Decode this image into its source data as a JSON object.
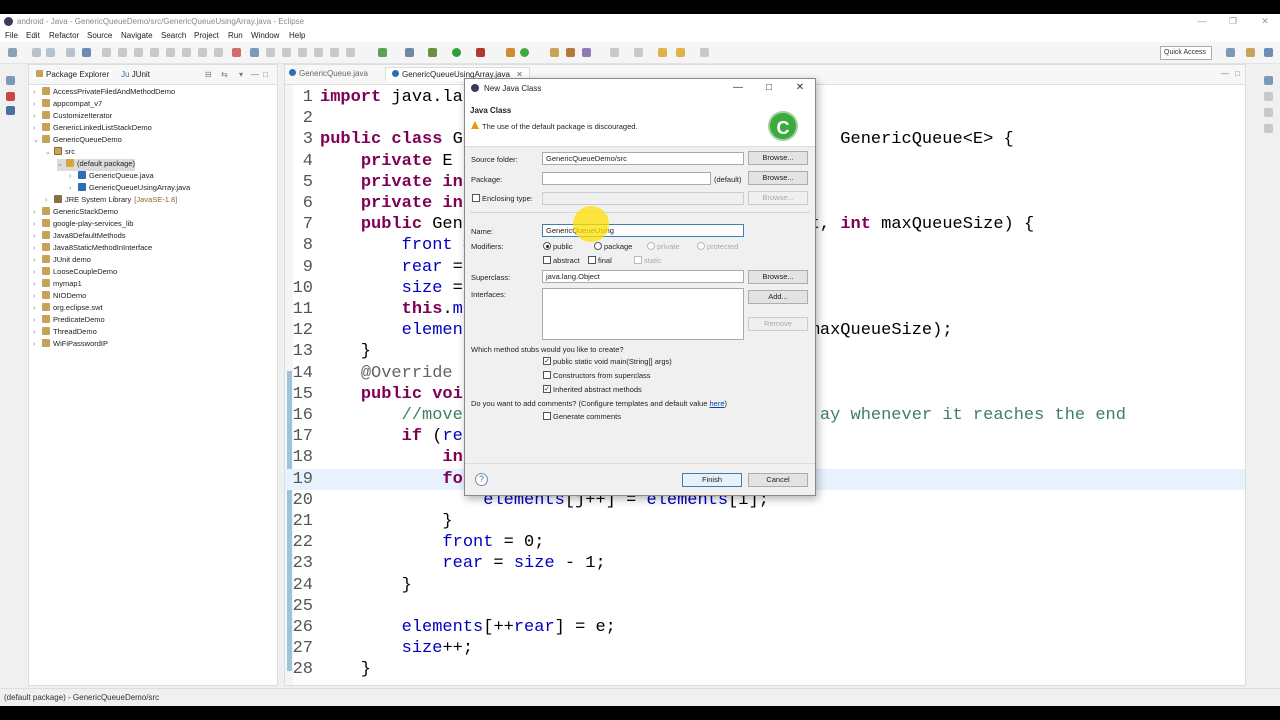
{
  "window": {
    "title": "android - Java - GenericQueueDemo/src/GenericQueueUsingArray.java - Eclipse"
  },
  "menu": [
    "File",
    "Edit",
    "Refactor",
    "Source",
    "Navigate",
    "Search",
    "Project",
    "Run",
    "Window",
    "Help"
  ],
  "toolbar": {
    "quick_access": "Quick Access"
  },
  "package_explorer": {
    "tabs": [
      "Package Explorer",
      "JUnit"
    ],
    "items": [
      {
        "label": "AccessPrivateFiledAndMethodDemo",
        "depth": 0,
        "expanded": false,
        "icon": "project"
      },
      {
        "label": "appcompat_v7",
        "depth": 0,
        "expanded": false,
        "icon": "project"
      },
      {
        "label": "CustomizeIterator",
        "depth": 0,
        "expanded": false,
        "icon": "project"
      },
      {
        "label": "GenericLinkedListStackDemo",
        "depth": 0,
        "expanded": false,
        "icon": "project"
      },
      {
        "label": "GenericQueueDemo",
        "depth": 0,
        "expanded": true,
        "icon": "project"
      },
      {
        "label": "src",
        "depth": 1,
        "expanded": true,
        "icon": "src"
      },
      {
        "label": "(default package)",
        "depth": 2,
        "expanded": true,
        "icon": "package",
        "selected": true
      },
      {
        "label": "GenericQueue.java",
        "depth": 3,
        "expanded": false,
        "icon": "java"
      },
      {
        "label": "GenericQueueUsingArray.java",
        "depth": 3,
        "expanded": false,
        "icon": "java"
      },
      {
        "label": "JRE System Library",
        "suffix": "[JavaSE-1.8]",
        "depth": 1,
        "expanded": false,
        "icon": "library"
      },
      {
        "label": "GenericStackDemo",
        "depth": 0,
        "expanded": false,
        "icon": "project"
      },
      {
        "label": "google-play-services_lib",
        "depth": 0,
        "expanded": false,
        "icon": "project"
      },
      {
        "label": "Java8DefaultMethods",
        "depth": 0,
        "expanded": false,
        "icon": "project"
      },
      {
        "label": "Java8StaticMethodInInterface",
        "depth": 0,
        "expanded": false,
        "icon": "project"
      },
      {
        "label": "JUnit demo",
        "depth": 0,
        "expanded": false,
        "icon": "project"
      },
      {
        "label": "LooseCoupleDemo",
        "depth": 0,
        "expanded": false,
        "icon": "project"
      },
      {
        "label": "mymap1",
        "depth": 0,
        "expanded": false,
        "icon": "project"
      },
      {
        "label": "NIODemo",
        "depth": 0,
        "expanded": false,
        "icon": "project"
      },
      {
        "label": "org.eclipse.swt",
        "depth": 0,
        "expanded": false,
        "icon": "project"
      },
      {
        "label": "PredicateDemo",
        "depth": 0,
        "expanded": false,
        "icon": "project"
      },
      {
        "label": "ThreadDemo",
        "depth": 0,
        "expanded": false,
        "icon": "project"
      },
      {
        "label": "WiFiPasswordIP",
        "depth": 0,
        "expanded": false,
        "icon": "project"
      }
    ]
  },
  "editor": {
    "tabs": [
      "GenericQueue.java",
      "GenericQueueUsingArray.java"
    ],
    "lines": [
      {
        "n": "1",
        "html": "<span class='kw'>import</span> java.lar"
      },
      {
        "n": "2",
        "html": ""
      },
      {
        "n": "3",
        "html": "<span class='kw'>public class</span> Ge                                    GenericQueue&lt;E&gt; {"
      },
      {
        "n": "4",
        "html": "    <span class='kw'>private</span> E <span class='fld'>e</span>"
      },
      {
        "n": "5",
        "html": "    <span class='kw'>private int</span>"
      },
      {
        "n": "6",
        "html": "    <span class='kw'>private int</span>"
      },
      {
        "n": "7",
        "html": "    <span class='kw'>public</span> Gene                                 t, <span class='kw'>int</span> maxQueueSize) {"
      },
      {
        "n": "8",
        "html": "        <span class='fld'>front</span> ="
      },
      {
        "n": "9",
        "html": "        <span class='fld'>rear</span> ="
      },
      {
        "n": "10",
        "html": "        <span class='fld'>size</span> ="
      },
      {
        "n": "11",
        "html": "        <span class='kw'>this</span>.<span class='fld'>ma</span>"
      },
      {
        "n": "12",
        "html": "        <span class='fld'>element</span>                                 maxQueueSize);"
      },
      {
        "n": "13",
        "html": "    }"
      },
      {
        "n": "14",
        "html": "    <span class='an'>@Override</span>"
      },
      {
        "n": "15",
        "html": "    <span class='kw'>public voi</span>"
      },
      {
        "n": "16",
        "html": "        <span class='cm'>//moves                                  ay whenever it reaches the end</span>"
      },
      {
        "n": "17",
        "html": "        <span class='kw'>if</span> (<span class='fld'>rea</span>"
      },
      {
        "n": "18",
        "html": "            <span class='kw'>int</span>"
      },
      {
        "n": "19",
        "html": "            <span class='kw'>for</span>"
      },
      {
        "n": "20",
        "html": "                <span class='fld'>elements</span>[j++] = <span class='fld'>elements</span>[i];"
      },
      {
        "n": "21",
        "html": "            }"
      },
      {
        "n": "22",
        "html": "            <span class='fld'>front</span> = 0;"
      },
      {
        "n": "23",
        "html": "            <span class='fld'>rear</span> = <span class='fld'>size</span> - 1;"
      },
      {
        "n": "24",
        "html": "        }"
      },
      {
        "n": "25",
        "html": ""
      },
      {
        "n": "26",
        "html": "        <span class='fld'>elements</span>[++<span class='fld'>rear</span>] = e;"
      },
      {
        "n": "27",
        "html": "        <span class='fld'>size</span>++;"
      },
      {
        "n": "28",
        "html": "    }"
      }
    ]
  },
  "dialog": {
    "title": "New Java Class",
    "header_title": "Java Class",
    "header_message": "The use of the default package is discouraged.",
    "source_folder_label": "Source folder:",
    "source_folder_value": "GenericQueueDemo/src",
    "package_label": "Package:",
    "package_value": "",
    "package_default": "(default)",
    "enclosing_type_label": "Enclosing type:",
    "enclosing_type_value": "",
    "name_label": "Name:",
    "name_value": "GenericQueueUsing",
    "modifiers_label": "Modifiers:",
    "modifier_public": "public",
    "modifier_package": "package",
    "modifier_private": "private",
    "modifier_protected": "protected",
    "modifier_abstract": "abstract",
    "modifier_final": "final",
    "modifier_static": "static",
    "superclass_label": "Superclass:",
    "superclass_value": "java.lang.Object",
    "interfaces_label": "Interfaces:",
    "browse": "Browse...",
    "add": "Add...",
    "remove": "Remove",
    "stubs_question": "Which method stubs would you like to create?",
    "stub_main": "public static void main(String[] args)",
    "stub_constructors": "Constructors from superclass",
    "stub_inherited": "Inherited abstract methods",
    "comments_question_prefix": "Do you want to add comments? (Configure templates and default value ",
    "comments_link": "here",
    "comments_question_suffix": ")",
    "generate_comments": "Generate comments",
    "finish": "Finish",
    "cancel": "Cancel",
    "help_glyph": "?",
    "logo_glyph": "C"
  },
  "status": {
    "text": "(default package) - GenericQueueDemo/src"
  },
  "colors": {
    "keyword": "#7f0055",
    "comment": "#3f7f5f",
    "field": "#0000c0",
    "dialog_bg": "#f0f0f0",
    "cursor_highlight": "#ffe200"
  }
}
